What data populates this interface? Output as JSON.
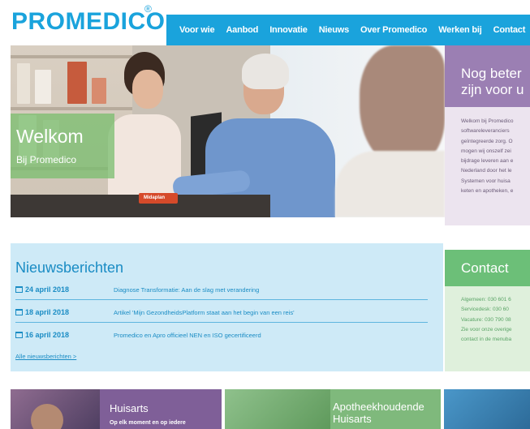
{
  "header": {
    "logo": "PROMEDICO",
    "logo_mark": "®",
    "nav": [
      "Voor wie",
      "Aanbod",
      "Innovatie",
      "Nieuws",
      "Over Promedico",
      "Werken bij",
      "Contact"
    ]
  },
  "hero": {
    "title": "Welkom",
    "subtitle": "Bij Promedico",
    "product_label": "Midaplan"
  },
  "intro": {
    "title_line1": "Nog beter",
    "title_line2": "zijn voor u",
    "text_lines": [
      "Welkom bij Promedico",
      "softwareleveranciers",
      "geïntegreerde zorg. O",
      "mogen wij onszelf zei",
      "bijdrage leveren aan e",
      "Nederland door het le",
      "Systemen voor huisa",
      "keten en apotheken, e"
    ]
  },
  "news": {
    "title": "Nieuwsberichten",
    "items": [
      {
        "date": "24 april 2018",
        "text": "Diagnose Transformatie: Aan de slag met verandering"
      },
      {
        "date": "18 april 2018",
        "text": "Artikel 'Mijn GezondheidsPlatform staat aan het begin van een reis'"
      },
      {
        "date": "16 april 2018",
        "text": "Promedico en Apro officieel NEN en ISO gecertificeerd"
      }
    ],
    "all_link": "Alle nieuwsberichten >"
  },
  "contact": {
    "title": "Contact",
    "lines": [
      "Algemeen: 030 601 6",
      "Servicedesk: 030 60",
      "Vacature: 030 790 08",
      "Zie voor onze overige",
      "contact in de menuba"
    ]
  },
  "tiles": [
    {
      "title": "Huisarts",
      "subtitle": "Op elk moment en op iedere"
    },
    {
      "title_line1": "Apotheekhoudende",
      "title_line2": "Huisarts"
    }
  ],
  "colors": {
    "brand_blue": "#1aa3dc",
    "purple": "#9b7fb3",
    "green": "#6cbf78",
    "news_bg": "#ceeaf7"
  }
}
